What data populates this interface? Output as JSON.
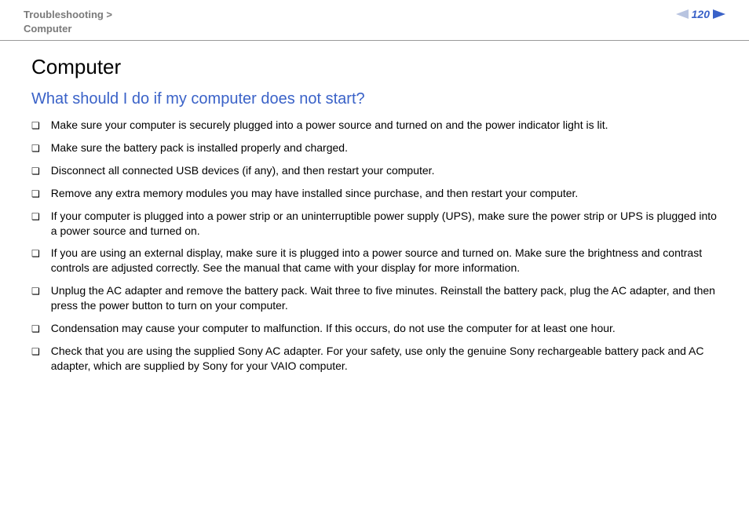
{
  "header": {
    "breadcrumb_line1": "Troubleshooting >",
    "breadcrumb_line2": "Computer",
    "page_number": "120"
  },
  "main": {
    "title": "Computer",
    "section_heading": "What should I do if my computer does not start?",
    "items": [
      "Make sure your computer is securely plugged into a power source and turned on and the power indicator light is lit.",
      "Make sure the battery pack is installed properly and charged.",
      "Disconnect all connected USB devices (if any), and then restart your computer.",
      "Remove any extra memory modules you may have installed since purchase, and then restart your computer.",
      "If your computer is plugged into a power strip or an uninterruptible power supply (UPS), make sure the power strip or UPS is plugged into a power source and turned on.",
      "If you are using an external display, make sure it is plugged into a power source and turned on. Make sure the brightness and contrast controls are adjusted correctly. See the manual that came with your display for more information.",
      "Unplug the AC adapter and remove the battery pack. Wait three to five minutes. Reinstall the battery pack, plug the AC adapter, and then press the power button to turn on your computer.",
      "Condensation may cause your computer to malfunction. If this occurs, do not use the computer for at least one hour.",
      "Check that you are using the supplied Sony AC adapter. For your safety, use only the genuine Sony rechargeable battery pack and AC adapter, which are supplied by Sony for your VAIO computer."
    ]
  },
  "icons": {
    "bullet": "❏"
  }
}
